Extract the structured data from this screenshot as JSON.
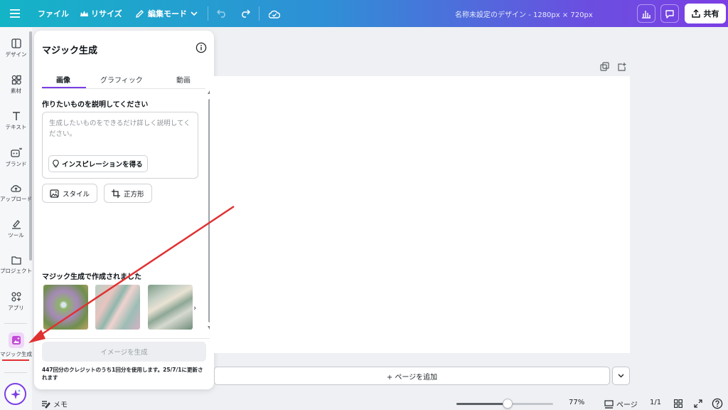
{
  "topbar": {
    "file": "ファイル",
    "resize": "リサイズ",
    "edit_mode": "編集モード",
    "doc_title": "名称未設定のデザイン - 1280px × 720px",
    "share": "共有",
    "icons": [
      "menu-icon",
      "crown-icon",
      "pencil-icon",
      "chevron-down-icon",
      "undo-icon",
      "redo-icon",
      "cloud-check-icon",
      "analytics-icon",
      "comment-icon",
      "upload-icon"
    ]
  },
  "rail": {
    "items": [
      {
        "label": "デザイン",
        "icon": "design-icon"
      },
      {
        "label": "素材",
        "icon": "elements-icon"
      },
      {
        "label": "テキスト",
        "icon": "text-icon"
      },
      {
        "label": "ブランド",
        "icon": "brand-icon"
      },
      {
        "label": "アップロード",
        "icon": "upload-cloud-icon"
      },
      {
        "label": "ツール",
        "icon": "draw-icon"
      },
      {
        "label": "プロジェクト",
        "icon": "folder-icon"
      },
      {
        "label": "アプリ",
        "icon": "apps-icon"
      },
      {
        "label": "マジック生成",
        "icon": "magic-media-icon"
      }
    ]
  },
  "panel": {
    "title": "マジック生成",
    "tabs": [
      "画像",
      "グラフィック",
      "動画"
    ],
    "active_tab": "画像",
    "prompt_label": "作りたいものを説明してください",
    "prompt_placeholder": "生成したいものをできるだけ詳しく説明してください。",
    "inspiration_button": "インスピレーションを得る",
    "style_button": "スタイル",
    "aspect_button": "正方形",
    "recent_label": "マジック生成で作成されました",
    "generate_button": "イメージを生成",
    "credits_text": "447回分のクレジットのうち1回分を使用します。25/7/1に更新されます"
  },
  "canvas": {
    "add_page": "+ ページを追加"
  },
  "bottombar": {
    "notes": "メモ",
    "zoom": "77%",
    "pages": "ページ",
    "page_count": "1/1",
    "zoom_fraction": 0.53
  },
  "colors": {
    "accent": "#7b3fe4",
    "annotation": "#e03131",
    "gradient_start": "#14b4c7",
    "gradient_end": "#7b3fe4"
  }
}
